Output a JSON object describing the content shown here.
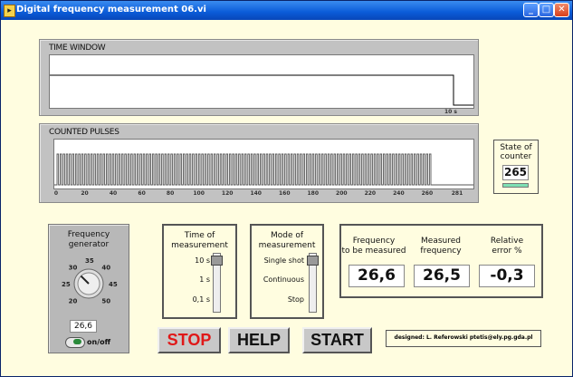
{
  "window": {
    "title": "Digital frequency measurement 06.vi",
    "min_label": "_",
    "max_label": "□",
    "close_label": "✕"
  },
  "time_window": {
    "label": "TIME WINDOW",
    "end_label": "10 s"
  },
  "counted_pulses": {
    "label": "COUNTED PULSES",
    "x_ticks": [
      "0",
      "20",
      "40",
      "60",
      "80",
      "100",
      "120",
      "140",
      "160",
      "180",
      "200",
      "220",
      "240",
      "260",
      "281"
    ],
    "pulse_count": 265,
    "axis_max": 281
  },
  "state_of_counter": {
    "title_line1": "State of",
    "title_line2": "counter",
    "value": "265",
    "led_color": "#7fe0b4"
  },
  "generator": {
    "title_line1": "Frequency",
    "title_line2": "generator",
    "dial_labels": [
      "20",
      "25",
      "30",
      "35",
      "40",
      "45",
      "50"
    ],
    "value": "26,6",
    "switch_label": "on/off",
    "level": 0.332
  },
  "time_of_measurement": {
    "title_line1": "Time of",
    "title_line2": "measurement",
    "options": [
      "10 s",
      "1 s",
      "0,1 s"
    ],
    "selected": "10 s"
  },
  "mode_of_measurement": {
    "title_line1": "Mode of",
    "title_line2": "measurement",
    "options": [
      "Single shot",
      "Continuous",
      "Stop"
    ],
    "selected": "Single shot"
  },
  "results": {
    "freq_title1": "Frequency",
    "freq_title2": "to be measured",
    "freq_value": "26,6",
    "meas_title1": "Measured",
    "meas_title2": "frequency",
    "meas_value": "26,5",
    "err_title1": "Relative",
    "err_title2": "error %",
    "err_value": "-0,3"
  },
  "buttons": {
    "stop": "STOP",
    "help": "HELP",
    "start": "START",
    "stop_color": "#e01818"
  },
  "credit": "designed: L. Referowski ptetis@ely.pg.gda.pl"
}
